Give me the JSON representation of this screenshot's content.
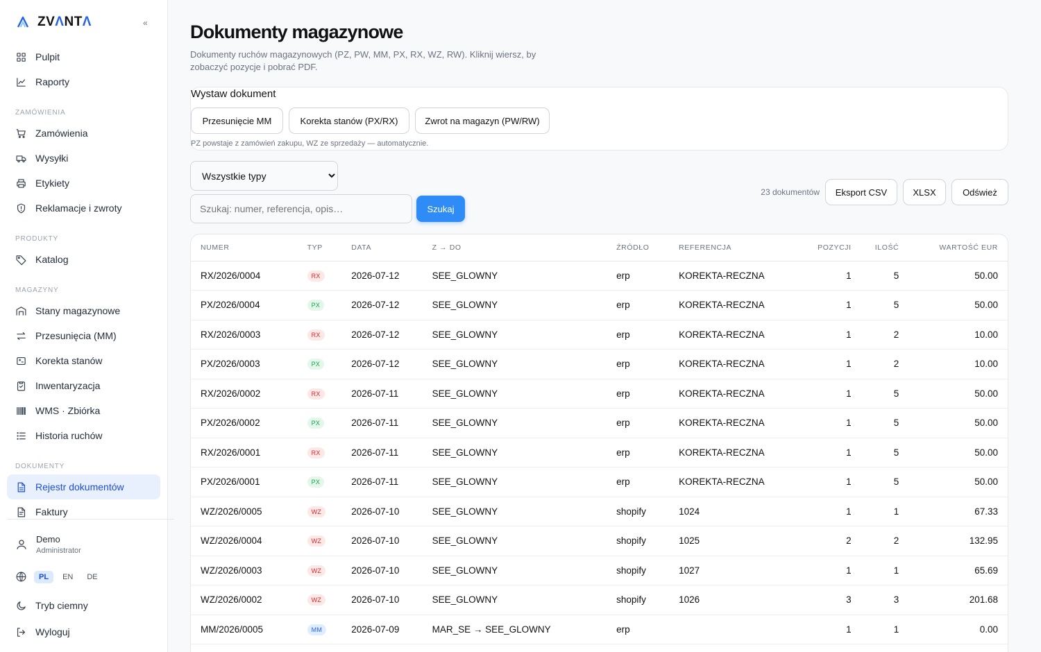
{
  "brand": {
    "name_part1": "ZV",
    "name_accent1": "Λ",
    "name_part2": "NT",
    "name_accent2": "Λ",
    "collapse": "«"
  },
  "nav": {
    "top": [
      {
        "label": "Pulpit",
        "icon": "grid-icon"
      },
      {
        "label": "Raporty",
        "icon": "chart-line-icon"
      }
    ],
    "sections": [
      {
        "title": "ZAMÓWIENIA",
        "items": [
          {
            "label": "Zamówienia",
            "icon": "cart-icon"
          },
          {
            "label": "Wysyłki",
            "icon": "truck-icon"
          },
          {
            "label": "Etykiety",
            "icon": "printer-icon"
          },
          {
            "label": "Reklamacje i zwroty",
            "icon": "shield-icon"
          }
        ]
      },
      {
        "title": "PRODUKTY",
        "items": [
          {
            "label": "Katalog",
            "icon": "tag-icon"
          }
        ]
      },
      {
        "title": "MAGAZYNY",
        "items": [
          {
            "label": "Stany magazynowe",
            "icon": "warehouse-icon"
          },
          {
            "label": "Przesunięcia (MM)",
            "icon": "transfer-icon"
          },
          {
            "label": "Korekta stanów",
            "icon": "adjust-icon"
          },
          {
            "label": "Inwentaryzacja",
            "icon": "clipboard-check-icon"
          },
          {
            "label": "WMS · Zbiórka",
            "icon": "barcode-icon"
          },
          {
            "label": "Historia ruchów",
            "icon": "list-icon"
          }
        ]
      },
      {
        "title": "DOKUMENTY",
        "items": [
          {
            "label": "Rejestr dokumentów",
            "icon": "document-icon",
            "active": true
          },
          {
            "label": "Faktury",
            "icon": "invoice-icon"
          }
        ]
      }
    ]
  },
  "user": {
    "name": "Demo",
    "role": "Administrator"
  },
  "languages": [
    "PL",
    "EN",
    "DE"
  ],
  "active_language": "PL",
  "dark_mode_label": "Tryb ciemny",
  "logout_label": "Wyloguj",
  "page": {
    "title": "Dokumenty magazynowe",
    "subtitle": "Dokumenty ruchów magazynowych (PZ, PW, MM, PX, RX, WZ, RW). Kliknij wiersz, by zobaczyć pozycje i pobrać PDF."
  },
  "issue_card": {
    "title": "Wystaw dokument",
    "buttons": [
      "Przesunięcie MM",
      "Korekta stanów (PX/RX)",
      "Zwrot na magazyn (PW/RW)"
    ],
    "note": "PZ powstaje z zamówień zakupu, WZ ze sprzedaży — automatycznie."
  },
  "filters": {
    "type_selected": "Wszystkie typy",
    "search_placeholder": "Szukaj: numer, referencja, opis…",
    "search_button": "Szukaj",
    "count": "23 dokumentów",
    "export_csv": "Eksport CSV",
    "export_xlsx": "XLSX",
    "refresh": "Odśwież"
  },
  "table": {
    "headers": [
      "NUMER",
      "TYP",
      "DATA",
      "Z → DO",
      "ŹRÓDŁO",
      "REFERENCJA",
      "POZYCJI",
      "ILOŚĆ",
      "WARTOŚĆ EUR"
    ],
    "rows": [
      [
        "RX/2026/0004",
        "RX",
        "2026-07-12",
        "SEE_GLOWNY",
        "erp",
        "KOREKTA-RECZNA",
        "1",
        "5",
        "50.00"
      ],
      [
        "PX/2026/0004",
        "PX",
        "2026-07-12",
        "SEE_GLOWNY",
        "erp",
        "KOREKTA-RECZNA",
        "1",
        "5",
        "50.00"
      ],
      [
        "RX/2026/0003",
        "RX",
        "2026-07-12",
        "SEE_GLOWNY",
        "erp",
        "KOREKTA-RECZNA",
        "1",
        "2",
        "10.00"
      ],
      [
        "PX/2026/0003",
        "PX",
        "2026-07-12",
        "SEE_GLOWNY",
        "erp",
        "KOREKTA-RECZNA",
        "1",
        "2",
        "10.00"
      ],
      [
        "RX/2026/0002",
        "RX",
        "2026-07-11",
        "SEE_GLOWNY",
        "erp",
        "KOREKTA-RECZNA",
        "1",
        "5",
        "50.00"
      ],
      [
        "PX/2026/0002",
        "PX",
        "2026-07-11",
        "SEE_GLOWNY",
        "erp",
        "KOREKTA-RECZNA",
        "1",
        "5",
        "50.00"
      ],
      [
        "RX/2026/0001",
        "RX",
        "2026-07-11",
        "SEE_GLOWNY",
        "erp",
        "KOREKTA-RECZNA",
        "1",
        "5",
        "50.00"
      ],
      [
        "PX/2026/0001",
        "PX",
        "2026-07-11",
        "SEE_GLOWNY",
        "erp",
        "KOREKTA-RECZNA",
        "1",
        "5",
        "50.00"
      ],
      [
        "WZ/2026/0005",
        "WZ",
        "2026-07-10",
        "SEE_GLOWNY",
        "shopify",
        "1024",
        "1",
        "1",
        "67.33"
      ],
      [
        "WZ/2026/0004",
        "WZ",
        "2026-07-10",
        "SEE_GLOWNY",
        "shopify",
        "1025",
        "2",
        "2",
        "132.95"
      ],
      [
        "WZ/2026/0003",
        "WZ",
        "2026-07-10",
        "SEE_GLOWNY",
        "shopify",
        "1027",
        "1",
        "1",
        "65.69"
      ],
      [
        "WZ/2026/0002",
        "WZ",
        "2026-07-10",
        "SEE_GLOWNY",
        "shopify",
        "1026",
        "3",
        "3",
        "201.68"
      ],
      [
        "MM/2026/0005",
        "MM",
        "2026-07-09",
        "MAR_SE → SEE_GLOWNY",
        "erp",
        "",
        "1",
        "1",
        "0.00"
      ]
    ]
  }
}
